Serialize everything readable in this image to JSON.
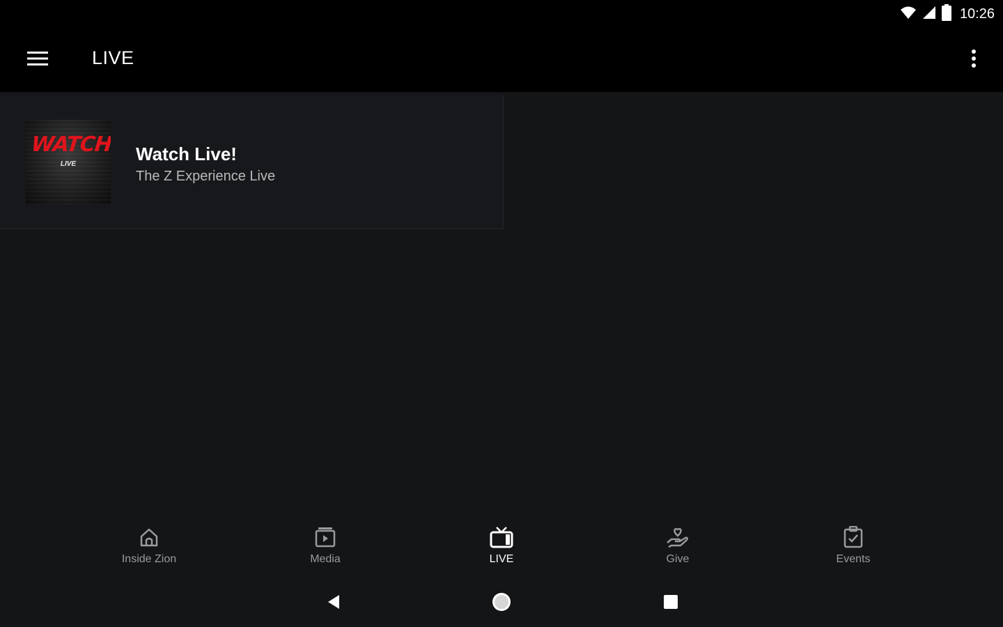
{
  "status_bar": {
    "time": "10:26",
    "icons": [
      "wifi-icon",
      "cell-signal-icon",
      "battery-icon"
    ]
  },
  "app_bar": {
    "title": "LIVE",
    "menu_icon": "hamburger-menu-icon",
    "overflow_icon": "more-vert-icon"
  },
  "live_item": {
    "title": "Watch Live!",
    "subtitle": "The Z Experience Live",
    "thumbnail": {
      "headline": "WATCH",
      "tag": "LIVE",
      "headline_color": "#e0141c"
    }
  },
  "bottom_nav": {
    "items": [
      {
        "label": "Inside Zion",
        "icon": "home-icon",
        "active": false
      },
      {
        "label": "Media",
        "icon": "media-play-icon",
        "active": false
      },
      {
        "label": "LIVE",
        "icon": "tv-icon",
        "active": true
      },
      {
        "label": "Give",
        "icon": "giving-hand-icon",
        "active": false
      },
      {
        "label": "Events",
        "icon": "calendar-check-icon",
        "active": false
      }
    ]
  },
  "system_nav": {
    "buttons": [
      "back-icon",
      "home-circle-icon",
      "recents-square-icon"
    ]
  },
  "colors": {
    "background": "#141517",
    "bar_background": "#000000",
    "card_background": "#17181b",
    "inactive_text": "#9a9b9e",
    "active_text": "#ffffff",
    "accent_red": "#e0141c"
  }
}
